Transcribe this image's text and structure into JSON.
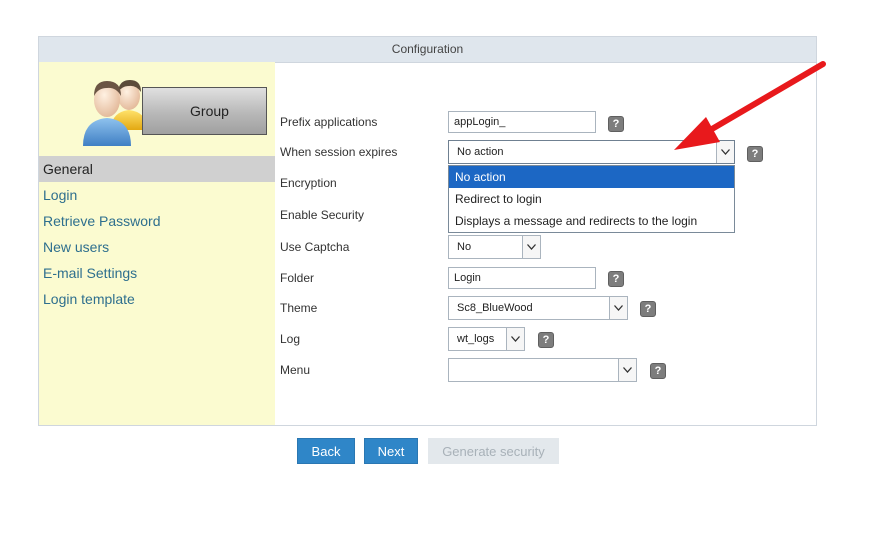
{
  "header": {
    "title": "Configuration"
  },
  "sidebar": {
    "group_label": "Group",
    "items": [
      {
        "label": "General",
        "active": true
      },
      {
        "label": "Login"
      },
      {
        "label": "Retrieve Password"
      },
      {
        "label": "New users"
      },
      {
        "label": "E-mail Settings"
      },
      {
        "label": "Login template"
      }
    ]
  },
  "form": {
    "prefix": {
      "label": "Prefix applications",
      "value": "appLogin_"
    },
    "session": {
      "label": "When session expires",
      "value": "No action",
      "options": [
        "No action",
        "Redirect to login",
        "Displays a message and redirects to the login"
      ]
    },
    "encryption": {
      "label": "Encryption"
    },
    "security": {
      "label": "Enable Security"
    },
    "captcha": {
      "label": "Use Captcha",
      "value": "No"
    },
    "folder": {
      "label": "Folder",
      "value": "Login"
    },
    "theme": {
      "label": "Theme",
      "value": "Sc8_BlueWood"
    },
    "log": {
      "label": "Log",
      "value": "wt_logs"
    },
    "menu": {
      "label": "Menu",
      "value": ""
    },
    "help_glyph": "?"
  },
  "buttons": {
    "back": "Back",
    "next": "Next",
    "generate": "Generate security"
  },
  "colors": {
    "accent": "#2f86c8",
    "sidebar_bg": "#fbfbd0",
    "annotation_arrow": "#e8191c",
    "selected_option": "#1c67c4"
  },
  "icons": [
    "users-group-icon",
    "help-icon",
    "chevron-down-icon",
    "annotation-arrow-icon"
  ]
}
